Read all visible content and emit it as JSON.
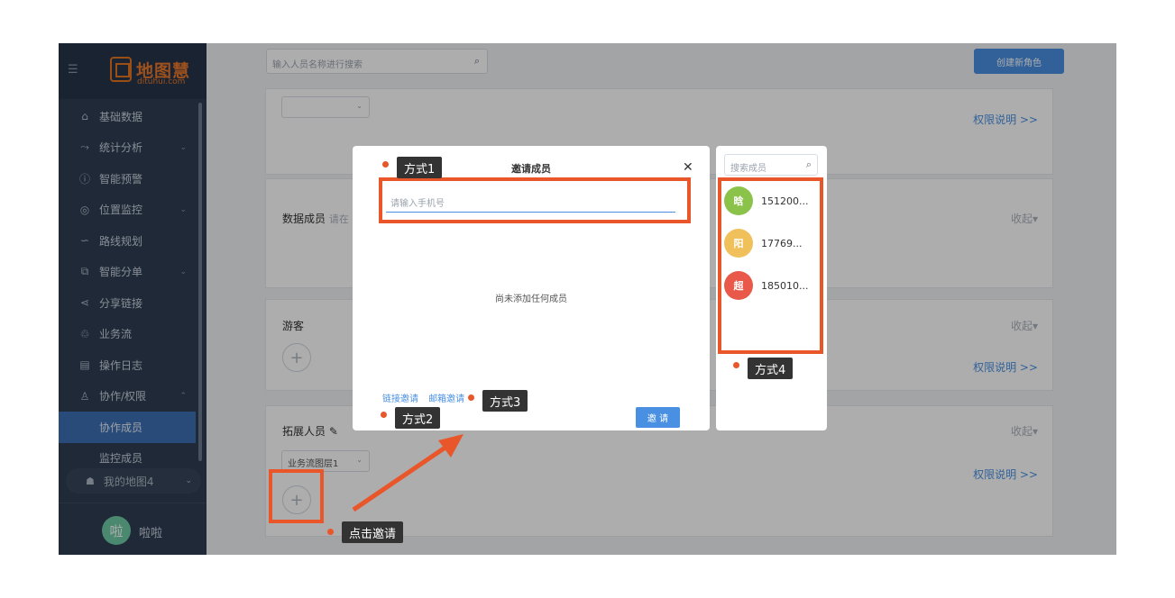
{
  "sidebar": {
    "logo_text": "地图慧",
    "logo_sub": "dituhui.com",
    "items": [
      {
        "label": "基础数据",
        "icon": "⌂",
        "chevron": false
      },
      {
        "label": "统计分析",
        "icon": "⤳",
        "chevron": true
      },
      {
        "label": "智能预警",
        "icon": "ⓘ",
        "chevron": false
      },
      {
        "label": "位置监控",
        "icon": "◎",
        "chevron": true
      },
      {
        "label": "路线规划",
        "icon": "∽",
        "chevron": false
      },
      {
        "label": "智能分单",
        "icon": "⧉",
        "chevron": true
      },
      {
        "label": "分享链接",
        "icon": "⋖",
        "chevron": false
      },
      {
        "label": "业务流",
        "icon": "♲",
        "chevron": false
      },
      {
        "label": "操作日志",
        "icon": "▤",
        "chevron": false
      },
      {
        "label": "协作/权限",
        "icon": "♙",
        "chevron": true
      }
    ],
    "sub_items": [
      {
        "label": "协作成员"
      },
      {
        "label": "监控成员"
      }
    ],
    "my_map": "我的地图4",
    "user": {
      "avatar": "啦",
      "name": "啦啦"
    }
  },
  "main": {
    "search_placeholder": "输入人员名称进行搜索",
    "create_button": "创建新角色",
    "permission_link": "权限说明 >>",
    "collapse_label": "收起",
    "data_members": {
      "title": "数据成员",
      "hint": "请在"
    },
    "guests": {
      "title": "游客"
    },
    "extended": {
      "title": "拓展人员",
      "select_value": "业务流图层1"
    }
  },
  "modal": {
    "title": "邀请成员",
    "phone_placeholder": "请输入手机号",
    "empty_text": "尚未添加任何成员",
    "link_invite": "链接邀请",
    "email_invite": "邮箱邀请",
    "invite_button": "邀 请"
  },
  "member_panel": {
    "search_placeholder": "搜索成员",
    "members": [
      {
        "avatar": "晗",
        "phone": "151200...",
        "color": "#8bc34a"
      },
      {
        "avatar": "阳",
        "phone": "17769...",
        "color": "#f0c05a"
      },
      {
        "avatar": "超",
        "phone": "185010...",
        "color": "#e8594a"
      }
    ]
  },
  "annotations": {
    "method1": "方式1",
    "method2": "方式2",
    "method3": "方式3",
    "method4": "方式4",
    "click_invite": "点击邀请",
    "accent_color": "#e8562a"
  }
}
